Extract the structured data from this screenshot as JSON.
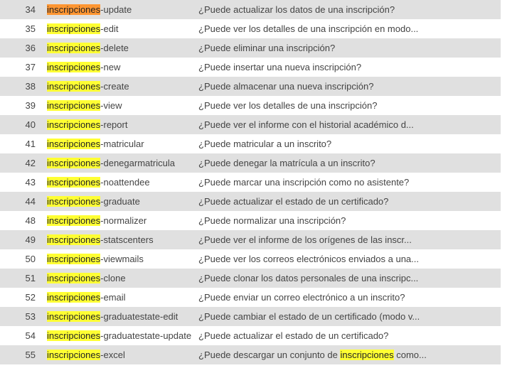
{
  "search": {
    "term": "inscripciones",
    "highlight_color": "#ffff33",
    "current_highlight_color": "#ff9632"
  },
  "colors": {
    "row_odd": "#e0e0e0",
    "row_even": "#ffffff",
    "text": "#444444"
  },
  "rows": [
    {
      "id": "34",
      "prefix": "inscripciones",
      "suffix": "-update",
      "desc": "¿Puede actualizar los datos de una inscripción?",
      "current": true
    },
    {
      "id": "35",
      "prefix": "inscripciones",
      "suffix": "-edit",
      "desc": "¿Puede ver los detalles de una inscripción en modo..."
    },
    {
      "id": "36",
      "prefix": "inscripciones",
      "suffix": "-delete",
      "desc": "¿Puede eliminar una inscripción?"
    },
    {
      "id": "37",
      "prefix": "inscripciones",
      "suffix": "-new",
      "desc": "¿Puede insertar una nueva inscripción?"
    },
    {
      "id": "38",
      "prefix": "inscripciones",
      "suffix": "-create",
      "desc": "¿Puede almacenar una nueva inscripción?"
    },
    {
      "id": "39",
      "prefix": "inscripciones",
      "suffix": "-view",
      "desc": "¿Puede ver los detalles de una inscripción?"
    },
    {
      "id": "40",
      "prefix": "inscripciones",
      "suffix": "-report",
      "desc": "¿Puede ver el informe con el historial académico d..."
    },
    {
      "id": "41",
      "prefix": "inscripciones",
      "suffix": "-matricular",
      "desc": "¿Puede matricular a un inscrito?"
    },
    {
      "id": "42",
      "prefix": "inscripciones",
      "suffix": "-denegarmatricula",
      "desc": "¿Puede denegar la matrícula a un inscrito?"
    },
    {
      "id": "43",
      "prefix": "inscripciones",
      "suffix": "-noattendee",
      "desc": "¿Puede marcar una inscripción como no asistente?"
    },
    {
      "id": "44",
      "prefix": "inscripciones",
      "suffix": "-graduate",
      "desc": "¿Puede actualizar el estado de un certificado?"
    },
    {
      "id": "48",
      "prefix": "inscripciones",
      "suffix": "-normalizer",
      "desc": "¿Puede normalizar una inscripción?"
    },
    {
      "id": "49",
      "prefix": "inscripciones",
      "suffix": "-statscenters",
      "desc": "¿Puede ver el informe de los orígenes de las inscr..."
    },
    {
      "id": "50",
      "prefix": "inscripciones",
      "suffix": "-viewmails",
      "desc": "¿Puede ver los correos electrónicos enviados a una..."
    },
    {
      "id": "51",
      "prefix": "inscripciones",
      "suffix": "-clone",
      "desc": "¿Puede clonar los datos personales de una inscripc..."
    },
    {
      "id": "52",
      "prefix": "inscripciones",
      "suffix": "-email",
      "desc": "¿Puede enviar un correo electrónico a un inscrito?"
    },
    {
      "id": "53",
      "prefix": "inscripciones",
      "suffix": "-graduatestate-edit",
      "desc": "¿Puede cambiar el estado de un certificado (modo v..."
    },
    {
      "id": "54",
      "prefix": "inscripciones",
      "suffix": "-graduatestate-update",
      "desc": "¿Puede actualizar el estado de un certificado?"
    },
    {
      "id": "55",
      "prefix": "inscripciones",
      "suffix": "-excel",
      "desc_before": "¿Puede descargar un conjunto de ",
      "desc_match": "inscripciones",
      "desc_after": " como..."
    }
  ]
}
